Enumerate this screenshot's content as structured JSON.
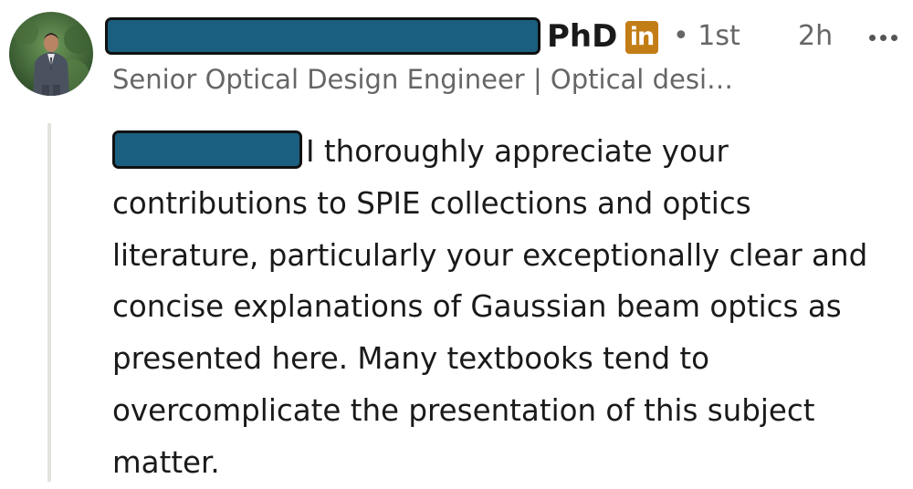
{
  "comment": {
    "author": {
      "degree_suffix": "PhD",
      "badge_text": "in",
      "connection_degree": "• 1st",
      "headline": "Senior Optical Design Engineer | Optical desi…"
    },
    "timestamp": "2h",
    "more_icon": "more-horizontal-icon",
    "body_lines": [
      "I thoroughly appreciate your",
      "contributions to SPIE collections and optics",
      "literature, particularly your exceptionally clear and",
      "concise explanations of Gaussian beam optics as",
      "presented here. Many textbooks tend to",
      "overcomplicate the presentation of this subject",
      "matter."
    ]
  },
  "colors": {
    "redaction_fill": "#1a5f7f",
    "linkedin_badge": "#c37d16",
    "quote_bar": "#e4e2dd"
  }
}
